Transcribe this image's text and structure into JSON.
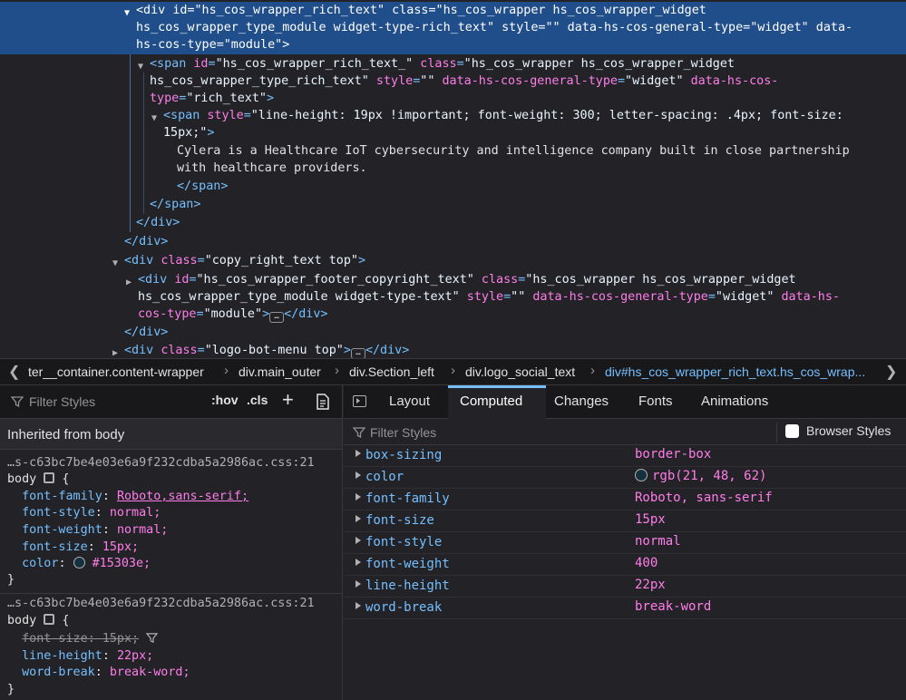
{
  "markup": {
    "lines": [
      {
        "indent": 150,
        "html_parts": [
          [
            "tag",
            "<div "
          ],
          [
            "attr",
            "id"
          ],
          [
            "tag",
            "="
          ],
          [
            "val",
            "\"hs_cos_wrapper_rich_text\" "
          ],
          [
            "attr",
            "class"
          ],
          [
            "tag",
            "="
          ],
          [
            "val",
            "\"hs_cos_wrapper hs_cos_wrapper_widget"
          ]
        ]
      },
      {
        "indent": 150,
        "html_parts": [
          [
            "val",
            "hs_cos_wrapper_type_module widget-type-rich_text\" "
          ],
          [
            "attr",
            "style"
          ],
          [
            "tag",
            "="
          ],
          [
            "val",
            "\"\" "
          ],
          [
            "attr",
            "data-hs-cos-general-type"
          ],
          [
            "tag",
            "="
          ],
          [
            "val",
            "\"widget\" "
          ],
          [
            "attr",
            "data-"
          ]
        ]
      },
      {
        "indent": 150,
        "html_parts": [
          [
            "attr",
            "hs-cos-type"
          ],
          [
            "tag",
            "="
          ],
          [
            "val",
            "\"module\""
          ],
          [
            "tag",
            ">"
          ]
        ]
      },
      {
        "indent": 165,
        "html_parts": [
          [
            "tag",
            "<span "
          ],
          [
            "attr",
            "id"
          ],
          [
            "tag",
            "="
          ],
          [
            "val",
            "\"hs_cos_wrapper_rich_text_\" "
          ],
          [
            "attr",
            "class"
          ],
          [
            "tag",
            "="
          ],
          [
            "val",
            "\"hs_cos_wrapper hs_cos_wrapper_widget"
          ]
        ]
      },
      {
        "indent": 165,
        "html_parts": [
          [
            "val",
            "hs_cos_wrapper_type_rich_text\" "
          ],
          [
            "attr",
            "style"
          ],
          [
            "tag",
            "="
          ],
          [
            "val",
            "\"\" "
          ],
          [
            "attr",
            "data-hs-cos-general-type"
          ],
          [
            "tag",
            "="
          ],
          [
            "val",
            "\"widget\" "
          ],
          [
            "attr",
            "data-hs-cos-"
          ]
        ]
      },
      {
        "indent": 165,
        "html_parts": [
          [
            "attr",
            "type"
          ],
          [
            "tag",
            "="
          ],
          [
            "val",
            "\"rich_text\""
          ],
          [
            "tag",
            ">"
          ]
        ]
      },
      {
        "indent": 180,
        "html_parts": [
          [
            "tag",
            "<span "
          ],
          [
            "attr",
            "style"
          ],
          [
            "tag",
            "="
          ],
          [
            "val",
            "\"line-height: 19px !important; font-weight: 300; letter-spacing: .4px; font-size:"
          ]
        ]
      },
      {
        "indent": 180,
        "html_parts": [
          [
            "val",
            "15px;\""
          ],
          [
            "tag",
            ">"
          ]
        ]
      },
      {
        "indent": 195,
        "html_parts": [
          [
            "txt",
            "Cylera is a Healthcare IoT cybersecurity and intelligence company built in close partnership"
          ]
        ]
      },
      {
        "indent": 195,
        "html_parts": [
          [
            "txt",
            "with healthcare providers."
          ]
        ]
      },
      {
        "indent": 195,
        "html_parts": [
          [
            "tag",
            "</span>"
          ]
        ]
      },
      {
        "indent": 165,
        "html_parts": [
          [
            "tag",
            "</span>"
          ]
        ]
      },
      {
        "indent": 150,
        "html_parts": [
          [
            "tag",
            "</div>"
          ]
        ]
      },
      {
        "indent": 137,
        "html_parts": [
          [
            "tag",
            "</div>"
          ]
        ]
      },
      {
        "indent": 137,
        "html_parts": [
          [
            "tag",
            "<div "
          ],
          [
            "attr",
            "class"
          ],
          [
            "tag",
            "="
          ],
          [
            "val",
            "\"copy_right_text top\""
          ],
          [
            "tag",
            ">"
          ]
        ]
      },
      {
        "indent": 152,
        "html_parts": [
          [
            "tag",
            "<div "
          ],
          [
            "attr",
            "id"
          ],
          [
            "tag",
            "="
          ],
          [
            "val",
            "\"hs_cos_wrapper_footer_copyright_text\" "
          ],
          [
            "attr",
            "class"
          ],
          [
            "tag",
            "="
          ],
          [
            "val",
            "\"hs_cos_wrapper hs_cos_wrapper_widget"
          ]
        ]
      },
      {
        "indent": 152,
        "html_parts": [
          [
            "val",
            "hs_cos_wrapper_type_module widget-type-text\" "
          ],
          [
            "attr",
            "style"
          ],
          [
            "tag",
            "="
          ],
          [
            "val",
            "\"\" "
          ],
          [
            "attr",
            "data-hs-cos-general-type"
          ],
          [
            "tag",
            "="
          ],
          [
            "val",
            "\"widget\" "
          ],
          [
            "attr",
            "data-hs-"
          ]
        ]
      },
      {
        "indent": 152,
        "html_parts": [
          [
            "attr",
            "cos-type"
          ],
          [
            "tag",
            "="
          ],
          [
            "val",
            "\"module\""
          ],
          [
            "tag",
            ">"
          ],
          [
            "ellipsis",
            "…"
          ],
          [
            "tag",
            "</div>"
          ]
        ]
      },
      {
        "indent": 137,
        "html_parts": [
          [
            "tag",
            "</div>"
          ]
        ]
      },
      {
        "indent": 137,
        "html_parts": [
          [
            "tag",
            "<div "
          ],
          [
            "attr",
            "class"
          ],
          [
            "tag",
            "="
          ],
          [
            "val",
            "\"logo-bot-menu top\""
          ],
          [
            "tag",
            ">"
          ],
          [
            "ellipsis",
            "…"
          ],
          [
            "tag",
            "</div>"
          ]
        ]
      }
    ]
  },
  "breadcrumb": {
    "items": [
      {
        "text": "ter__container.content-wrapper"
      },
      {
        "text": "div.main_outer"
      },
      {
        "text": "div.Section_left"
      },
      {
        "text": "div.logo_social_text"
      },
      {
        "text": "div#hs_cos_wrapper_rich_text.hs_cos_wrap..."
      }
    ]
  },
  "rules": {
    "filter_placeholder": "Filter Styles",
    "hov_label": ":hov",
    "cls_label": ".cls",
    "add_label": "+",
    "inherited_header": "Inherited from body",
    "rule1": {
      "source": "…s-c63bc7be4e03e6a9f232cdba5a2986ac.css:21",
      "selector": "body",
      "open": "{",
      "close": "}",
      "decls": [
        {
          "name": "font-family",
          "value": "Roboto,sans-serif;"
        },
        {
          "name": "font-style",
          "value": "normal;"
        },
        {
          "name": "font-weight",
          "value": "normal;"
        },
        {
          "name": "font-size",
          "value": "15px;"
        },
        {
          "name": "color",
          "value": "#15303e;"
        }
      ]
    },
    "rule2": {
      "source": "…s-c63bc7be4e03e6a9f232cdba5a2986ac.css:21",
      "selector": "body",
      "open": "{",
      "close": "}",
      "decls": [
        {
          "name": "font-size",
          "value": "15px;"
        },
        {
          "name": "line-height",
          "value": "22px;"
        },
        {
          "name": "word-break",
          "value": "break-word;"
        }
      ]
    }
  },
  "computed": {
    "tabs": [
      "Layout",
      "Computed",
      "Changes",
      "Fonts",
      "Animations"
    ],
    "active_tab": "Computed",
    "filter_placeholder": "Filter Styles",
    "browser_styles_label": "Browser Styles",
    "props": [
      {
        "name": "box-sizing",
        "value": "border-box"
      },
      {
        "name": "color",
        "value": "rgb(21, 48, 62)"
      },
      {
        "name": "font-family",
        "value": "Roboto, sans-serif"
      },
      {
        "name": "font-size",
        "value": "15px"
      },
      {
        "name": "font-style",
        "value": "normal"
      },
      {
        "name": "font-weight",
        "value": "400"
      },
      {
        "name": "line-height",
        "value": "22px"
      },
      {
        "name": "word-break",
        "value": "break-word"
      }
    ]
  },
  "colors": {
    "accent": "#75bfff",
    "selection": "#204e8a",
    "body_color_swatch": "#15303e"
  }
}
